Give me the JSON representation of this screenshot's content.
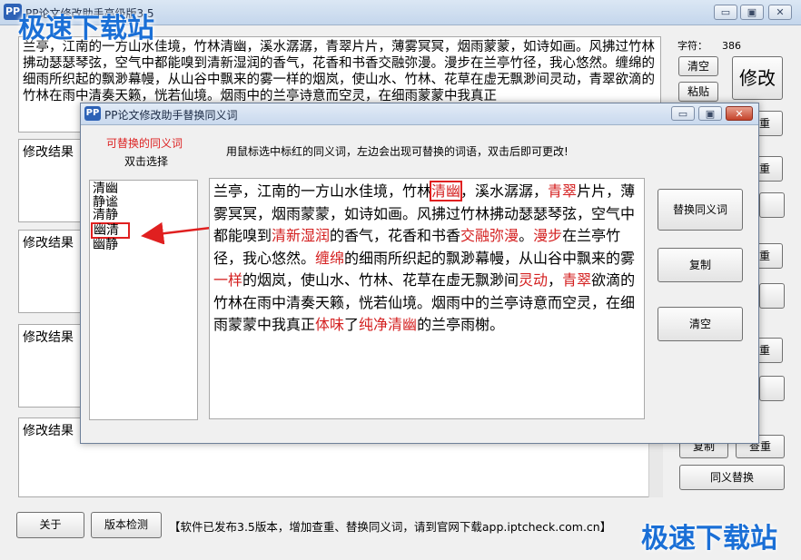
{
  "window": {
    "title": "PP论文修改助手高级版3.5",
    "min": "▭",
    "max": "▣",
    "close": "✕"
  },
  "source_text": "兰亭，江南的一方山水佳境，竹林清幽，溪水潺潺，青翠片片，薄雾冥冥，烟雨蒙蒙，如诗如画。风拂过竹林拂动瑟瑟琴弦，空气中都能嗅到清新湿润的香气，花香和书香交融弥漫。漫步在兰亭竹径，我心悠然。缠绵的细雨所织起的飘渺幕幔，从山谷中飘来的雾一样的烟岚，使山水、竹林、花草在虚无飘渺间灵动，青翠欲滴的竹林在雨中清奏天籁，恍若仙境。烟雨中的兰亭诗意而空灵，在细雨蒙蒙中我真正",
  "char_count_label": "字符：",
  "char_count": "386",
  "result_label": "修改结果",
  "buttons": {
    "clear": "清空",
    "paste": "粘贴",
    "modify": "修改",
    "check": "查重",
    "copy": "复制",
    "synonym_replace": "同义替换",
    "about": "关于",
    "version_check": "版本检测"
  },
  "status_text": "【软件已发布3.5版本，增加查重、替换同义词，请到官网下载app.iptcheck.com.cn】",
  "watermarks": [
    "极速下载站",
    "极速下载站"
  ],
  "dialog": {
    "title": "PP论文修改助手替换同义词",
    "synonym_label": "可替换的同义词",
    "double_click_label": "双击选择",
    "instruction": "用鼠标选中标红的同义词，左边会出现可替换的词语，双击后即可更改!",
    "synonyms": [
      "清幽",
      "静谧",
      "清静",
      "幽清",
      "幽静"
    ],
    "selected_synonym": "幽清",
    "doc_segments": [
      {
        "t": "兰亭，江南的一方山水佳境，竹林",
        "s": "n"
      },
      {
        "t": "清幽",
        "s": "b"
      },
      {
        "t": "，溪水潺潺，",
        "s": "n"
      },
      {
        "t": "青翠",
        "s": "r"
      },
      {
        "t": "片片，薄雾冥冥，烟雨蒙蒙，如诗如画。风拂过竹林拂动瑟瑟琴弦，空气中都能嗅到",
        "s": "n"
      },
      {
        "t": "清新湿润",
        "s": "r"
      },
      {
        "t": "的香气，花香和书香",
        "s": "n"
      },
      {
        "t": "交融弥漫",
        "s": "r"
      },
      {
        "t": "。",
        "s": "n"
      },
      {
        "t": "漫步",
        "s": "r"
      },
      {
        "t": "在兰亭竹径，我心悠然。",
        "s": "n"
      },
      {
        "t": "缠绵",
        "s": "r"
      },
      {
        "t": "的细雨所织起的飘渺幕幔，从山谷中飘来的雾",
        "s": "n"
      },
      {
        "t": "一样",
        "s": "r"
      },
      {
        "t": "的烟岚，使山水、竹林、花草在虚无飘渺间",
        "s": "n"
      },
      {
        "t": "灵动",
        "s": "r"
      },
      {
        "t": "，",
        "s": "n"
      },
      {
        "t": "青翠",
        "s": "r"
      },
      {
        "t": "欲滴的竹林在雨中清奏天籁，恍若仙境。烟雨中的兰亭诗意而空灵，在细雨蒙蒙中我真正",
        "s": "n"
      },
      {
        "t": "体味",
        "s": "r"
      },
      {
        "t": "了",
        "s": "n"
      },
      {
        "t": "纯净清幽",
        "s": "r"
      },
      {
        "t": "的兰亭雨榭。",
        "s": "n"
      }
    ],
    "buttons": {
      "replace": "替换同义词",
      "copy": "复制",
      "clear": "清空"
    }
  }
}
